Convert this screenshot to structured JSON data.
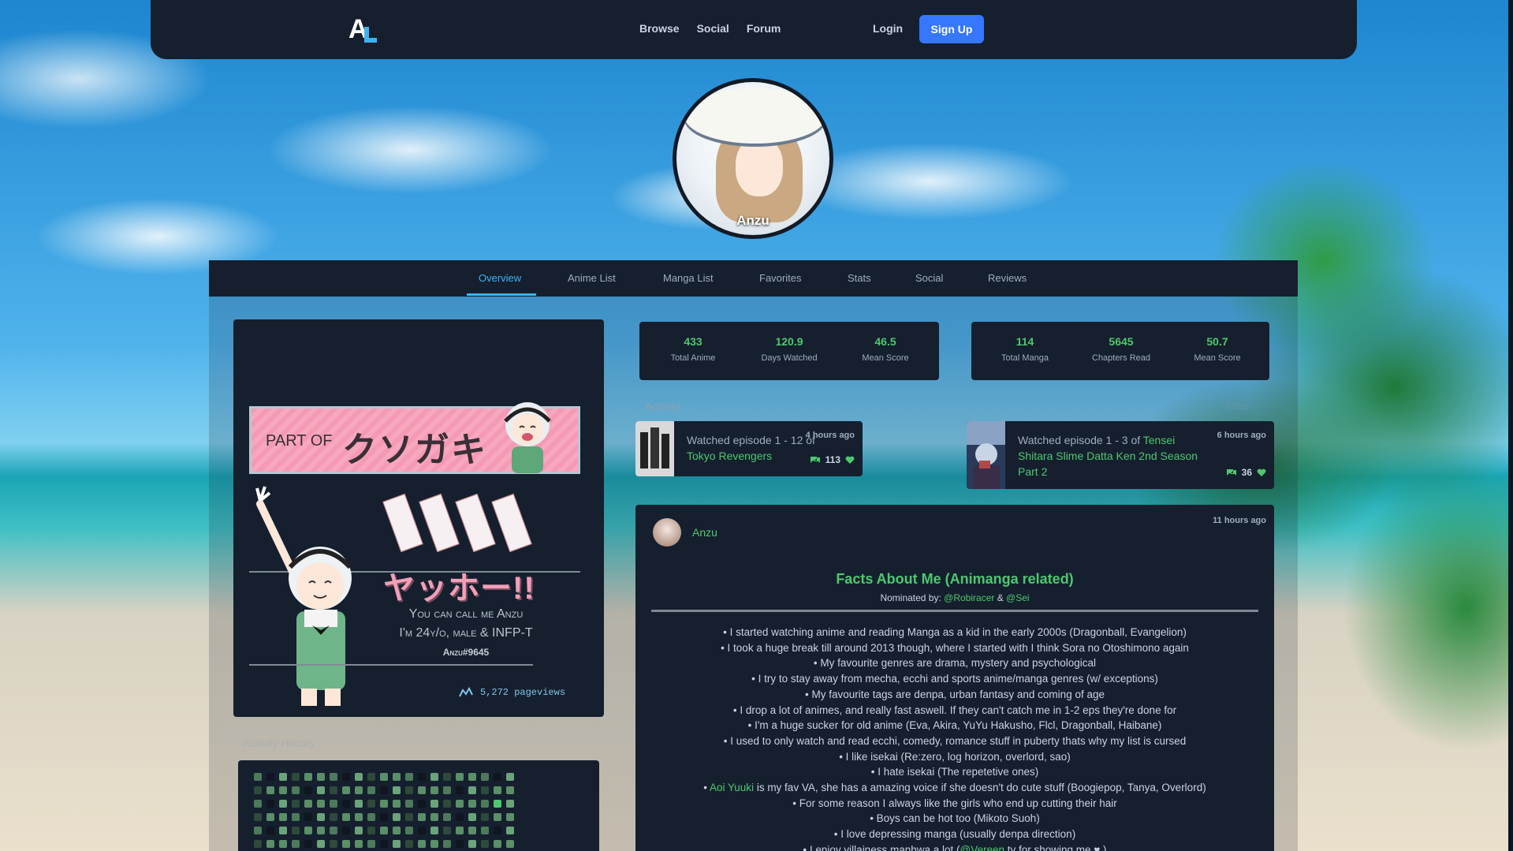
{
  "nav": {
    "logo": "AL",
    "links": [
      "Browse",
      "Social",
      "Forum"
    ],
    "login": "Login",
    "signup": "Sign Up"
  },
  "profile": {
    "username": "Anzu",
    "tabs": [
      "Overview",
      "Anime List",
      "Manga List",
      "Favorites",
      "Stats",
      "Social",
      "Reviews"
    ],
    "active_tab": "Overview"
  },
  "about": {
    "banner_part": "PART OF",
    "banner_jp": "クソガキ",
    "greeting": "ヤッホー!!",
    "intro_line1": "You can call me Anzu",
    "intro_line2": "I'm 24y/o, male & INFP-T",
    "intro_tag": "Anzu#9645",
    "pageviews": "5,272 pageviews"
  },
  "activity_history": {
    "label": "Activity History"
  },
  "anime_stats": [
    {
      "value": "433",
      "label": "Total Anime"
    },
    {
      "value": "120.9",
      "label": "Days Watched"
    },
    {
      "value": "46.5",
      "label": "Mean Score"
    }
  ],
  "manga_stats": [
    {
      "value": "114",
      "label": "Total Manga"
    },
    {
      "value": "5645",
      "label": "Chapters Read"
    },
    {
      "value": "50.7",
      "label": "Mean Score"
    }
  ],
  "activity": {
    "label": "Activity",
    "filter": "Filter",
    "items": [
      {
        "text": "Watched episode 1 - 12 of ",
        "media": "Tokyo Revengers",
        "time": "4 hours ago",
        "replies": "",
        "likes": "113"
      },
      {
        "text": "Watched episode 1 - 3 of ",
        "media": "Tensei Shitara Slime Datta Ken 2nd Season Part 2",
        "time": "6 hours ago",
        "replies": "",
        "likes": "36"
      }
    ]
  },
  "post": {
    "author": "Anzu",
    "time": "11 hours ago",
    "title": "Facts About Me (Animanga related)",
    "nominated_prefix": "Nominated by: ",
    "nominator1": "@Robiracer",
    "amp": " & ",
    "nominator2": "@Sei",
    "facts": [
      "I started watching anime and reading Manga as a kid in the early 2000s (Dragonball, Evangelion)",
      "I took a huge break till around 2013 though, where I started with I think Sora no Otoshimono again",
      "My favourite genres are drama, mystery and psychological",
      "I try to stay away from mecha, ecchi and sports anime/manga genres (w/ exceptions)",
      "My favourite tags are denpa, urban fantasy and coming of age",
      "I drop a lot of animes, and really fast aswell. If they can't catch me in 1-2 eps they're done for",
      "I'm a huge sucker for old anime (Eva, Akira, YuYu Hakusho, Flcl, Dragonball, Haibane)",
      "I used to only watch and read ecchi, comedy, romance stuff in puberty thats why my list is cursed",
      "I like isekai (Re:zero, log horizon, overlord, sao)",
      "I hate isekai (The repetetive ones)"
    ],
    "fact_va_name": "Aoi Yuuki",
    "fact_va_rest": " is my fav VA, she has a amazing voice if she doesn't do cute stuff (Boogiepop, Tanya, Overlord)",
    "facts_after": [
      "For some reason I always like the girls who end up cutting their hair",
      "Boys can be hot too (Mikoto Suoh)",
      "I love depressing manga (usually denpa direction)"
    ],
    "fact_last_prefix": "I enjoy villainess manhwa a lot (",
    "fact_last_mention": "@Vereen",
    "fact_last_suffix": " ty for showing me ♥ )"
  },
  "colors": {
    "accent_blue": "#3db4f2",
    "accent_green": "#4dc86e",
    "card_bg": "#151f2e",
    "signup_blue": "#3577ff"
  }
}
